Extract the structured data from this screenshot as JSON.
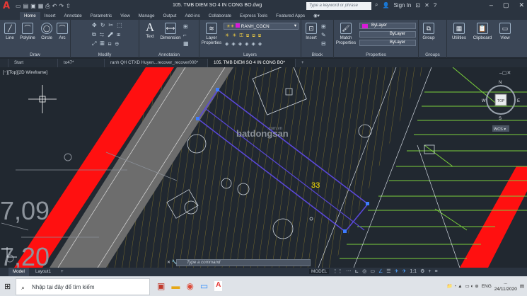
{
  "titlebar": {
    "title": "105. TMB DIEM SO 4 IN CONG BO.dwg",
    "search_placeholder": "Type a keyword or phrase",
    "signin": "Sign In"
  },
  "ribbon_tabs": [
    "Home",
    "Insert",
    "Annotate",
    "Parametric",
    "View",
    "Manage",
    "Output",
    "Add-ins",
    "Collaborate",
    "Express Tools",
    "Featured Apps"
  ],
  "ribbon": {
    "draw": {
      "label": "Draw",
      "tools": [
        "Line",
        "Polyline",
        "Circle",
        "Arc"
      ]
    },
    "modify": {
      "label": "Modify"
    },
    "annotation": {
      "label": "Annotation",
      "tools": [
        "Text",
        "Dimension"
      ]
    },
    "layers": {
      "label": "Layers",
      "layer_props": "Layer Properties",
      "current_layer": "RANH_CGCN"
    },
    "block": {
      "label": "Block",
      "insert": "Insert"
    },
    "properties": {
      "label": "Properties",
      "match": "Match Properties",
      "color": "ByLayer",
      "linetype": "ByLayer",
      "lineweight": "ByLayer"
    },
    "groups": {
      "label": "Groups",
      "group": "Group"
    },
    "utilities": "Utilities",
    "clipboard": "Clipboard",
    "view": "View"
  },
  "doc_tabs": [
    "Start",
    "to47*",
    "ranh QH CTXD Huyen...recover_recover000*",
    "105. TMB DIEM SO 4 IN CONG BO*"
  ],
  "viewport": {
    "label": "[−][Top][2D Wireframe]",
    "lot_number": "33",
    "big_text_1": "7,09",
    "big_text_2": "7,20",
    "watermark": "batdongsan",
    "watermark_domain": ".com.vn",
    "compass": {
      "n": "N",
      "s": "S",
      "e": "E",
      "w": "W",
      "top": "TOP"
    },
    "wcs": "WCS ▾"
  },
  "command": {
    "placeholder": "Type a command"
  },
  "layout_tabs": [
    "Model",
    "Layout1"
  ],
  "statusbar": {
    "model": "MODEL",
    "scale": "1:1"
  },
  "taskbar": {
    "search_placeholder": "Nhập tại đây để tìm kiếm",
    "lang": "ENG",
    "date": "24/11/2020",
    "time": "..."
  }
}
